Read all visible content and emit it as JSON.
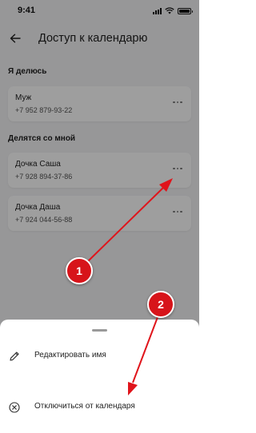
{
  "status_bar": {
    "time": "9:41"
  },
  "header": {
    "title": "Доступ к календарю"
  },
  "sharing": {
    "title": "Я делюсь",
    "items": [
      {
        "name": "Муж",
        "phone": "+7 952 879-93-22"
      }
    ]
  },
  "shared_with_me": {
    "title": "Делятся со мной",
    "items": [
      {
        "name": "Дочка Саша",
        "phone": "+7 928 894-37-86"
      },
      {
        "name": "Дочка Даша",
        "phone": "+7 924 044-56-88"
      }
    ]
  },
  "sheet": {
    "items": [
      {
        "label": "Редактировать имя",
        "icon": "pencil-icon"
      },
      {
        "label": "Отключиться от календаря",
        "icon": "close-circle-icon"
      }
    ]
  },
  "annotations": {
    "badge1": "1",
    "badge2": "2",
    "color": "#d7141a"
  }
}
